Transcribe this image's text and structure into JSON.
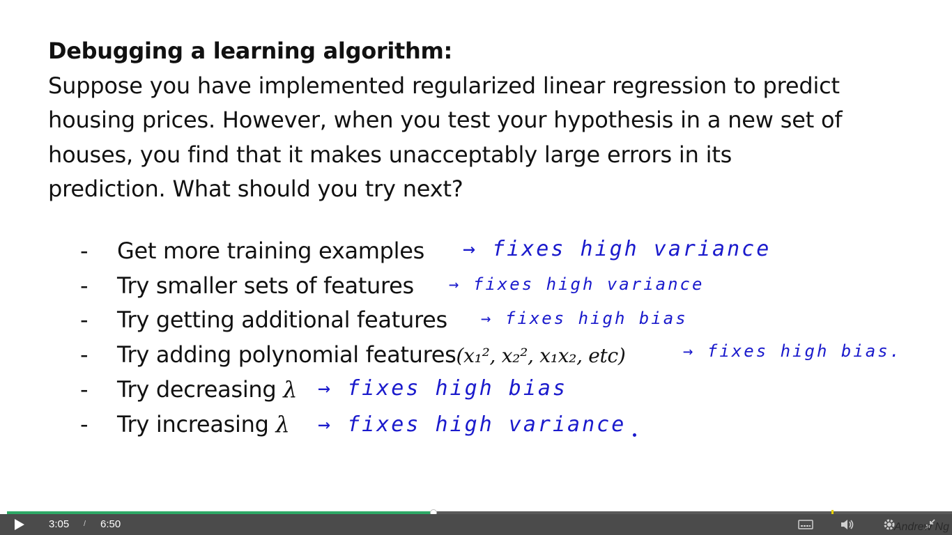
{
  "slide": {
    "title": "Debugging a learning algorithm:",
    "paragraph": [
      "Suppose you have implemented regularized linear regression to predict",
      "housing prices. However, when you test your hypothesis in a new set of",
      "houses, you find that it makes unacceptably large errors in its",
      "prediction.  What should you try next?"
    ],
    "bullets": [
      {
        "dash": "-",
        "text": "Get more training examples",
        "math": "",
        "note": "fixes high variance"
      },
      {
        "dash": "-",
        "text": "Try smaller sets of features",
        "math": "",
        "note": "fixes high variance"
      },
      {
        "dash": "-",
        "text": "Try getting additional features",
        "math": "",
        "note": "fixes high bias"
      },
      {
        "dash": "-",
        "text": "Try adding polynomial features",
        "math": "(x₁², x₂², x₁x₂, etc)",
        "note": "fixes high bias."
      },
      {
        "dash": "-",
        "text": "Try decreasing",
        "math": "λ",
        "note": "fixes high bias"
      },
      {
        "dash": "-",
        "text": "Try increasing",
        "math": "λ",
        "note": "fixes high variance"
      }
    ],
    "arrow": "→",
    "watermark": "Andrew Ng"
  },
  "player": {
    "current_time": "3:05",
    "separator": "/",
    "duration": "6:50",
    "progress_fraction": 0.451,
    "accent_color": "#2ea866",
    "icons": [
      "play-icon",
      "captions-icon",
      "volume-icon",
      "settings-icon",
      "fullscreen-exit-icon"
    ]
  }
}
